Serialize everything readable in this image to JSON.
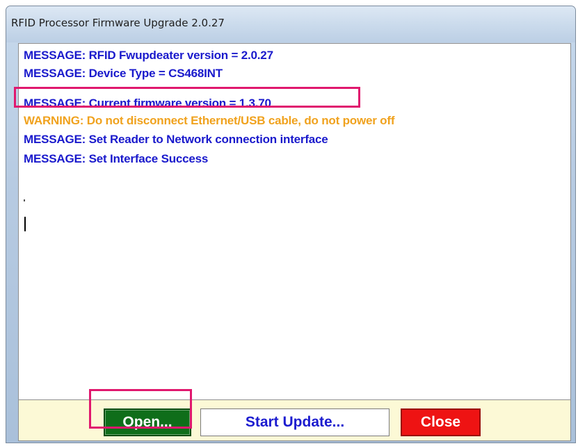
{
  "window": {
    "title": "RFID Processor Firmware Upgrade 2.0.27"
  },
  "log": {
    "lines": [
      {
        "text": "MESSAGE: RFID Fwupdeater version = 2.0.27",
        "kind": "message",
        "color": "#1a1acc"
      },
      {
        "text": "MESSAGE: Device Type = CS468INT",
        "kind": "message",
        "color": "#1a1acc"
      },
      {
        "text": "MESSAGE: Current firmware version = 1.3.70",
        "kind": "message",
        "color": "#1a1acc",
        "highlighted": true
      },
      {
        "text": "WARNING: Do not disconnect Ethernet/USB cable, do not power off",
        "kind": "warning",
        "color": "#f0a21e"
      },
      {
        "text": "MESSAGE: Set Reader to Network connection interface",
        "kind": "message",
        "color": "#1a1acc"
      },
      {
        "text": "MESSAGE: Set Interface Success",
        "kind": "message",
        "color": "#1a1acc"
      }
    ]
  },
  "buttons": {
    "open_label": "Open...",
    "start_update_label": "Start Update...",
    "close_label": "Close"
  },
  "colors": {
    "highlight": "#e0186e",
    "open_button_bg": "#0f6e1a",
    "close_button_bg": "#ee1313",
    "start_button_text": "#1c1ccf",
    "bottom_panel_bg": "#fcf9d6"
  }
}
